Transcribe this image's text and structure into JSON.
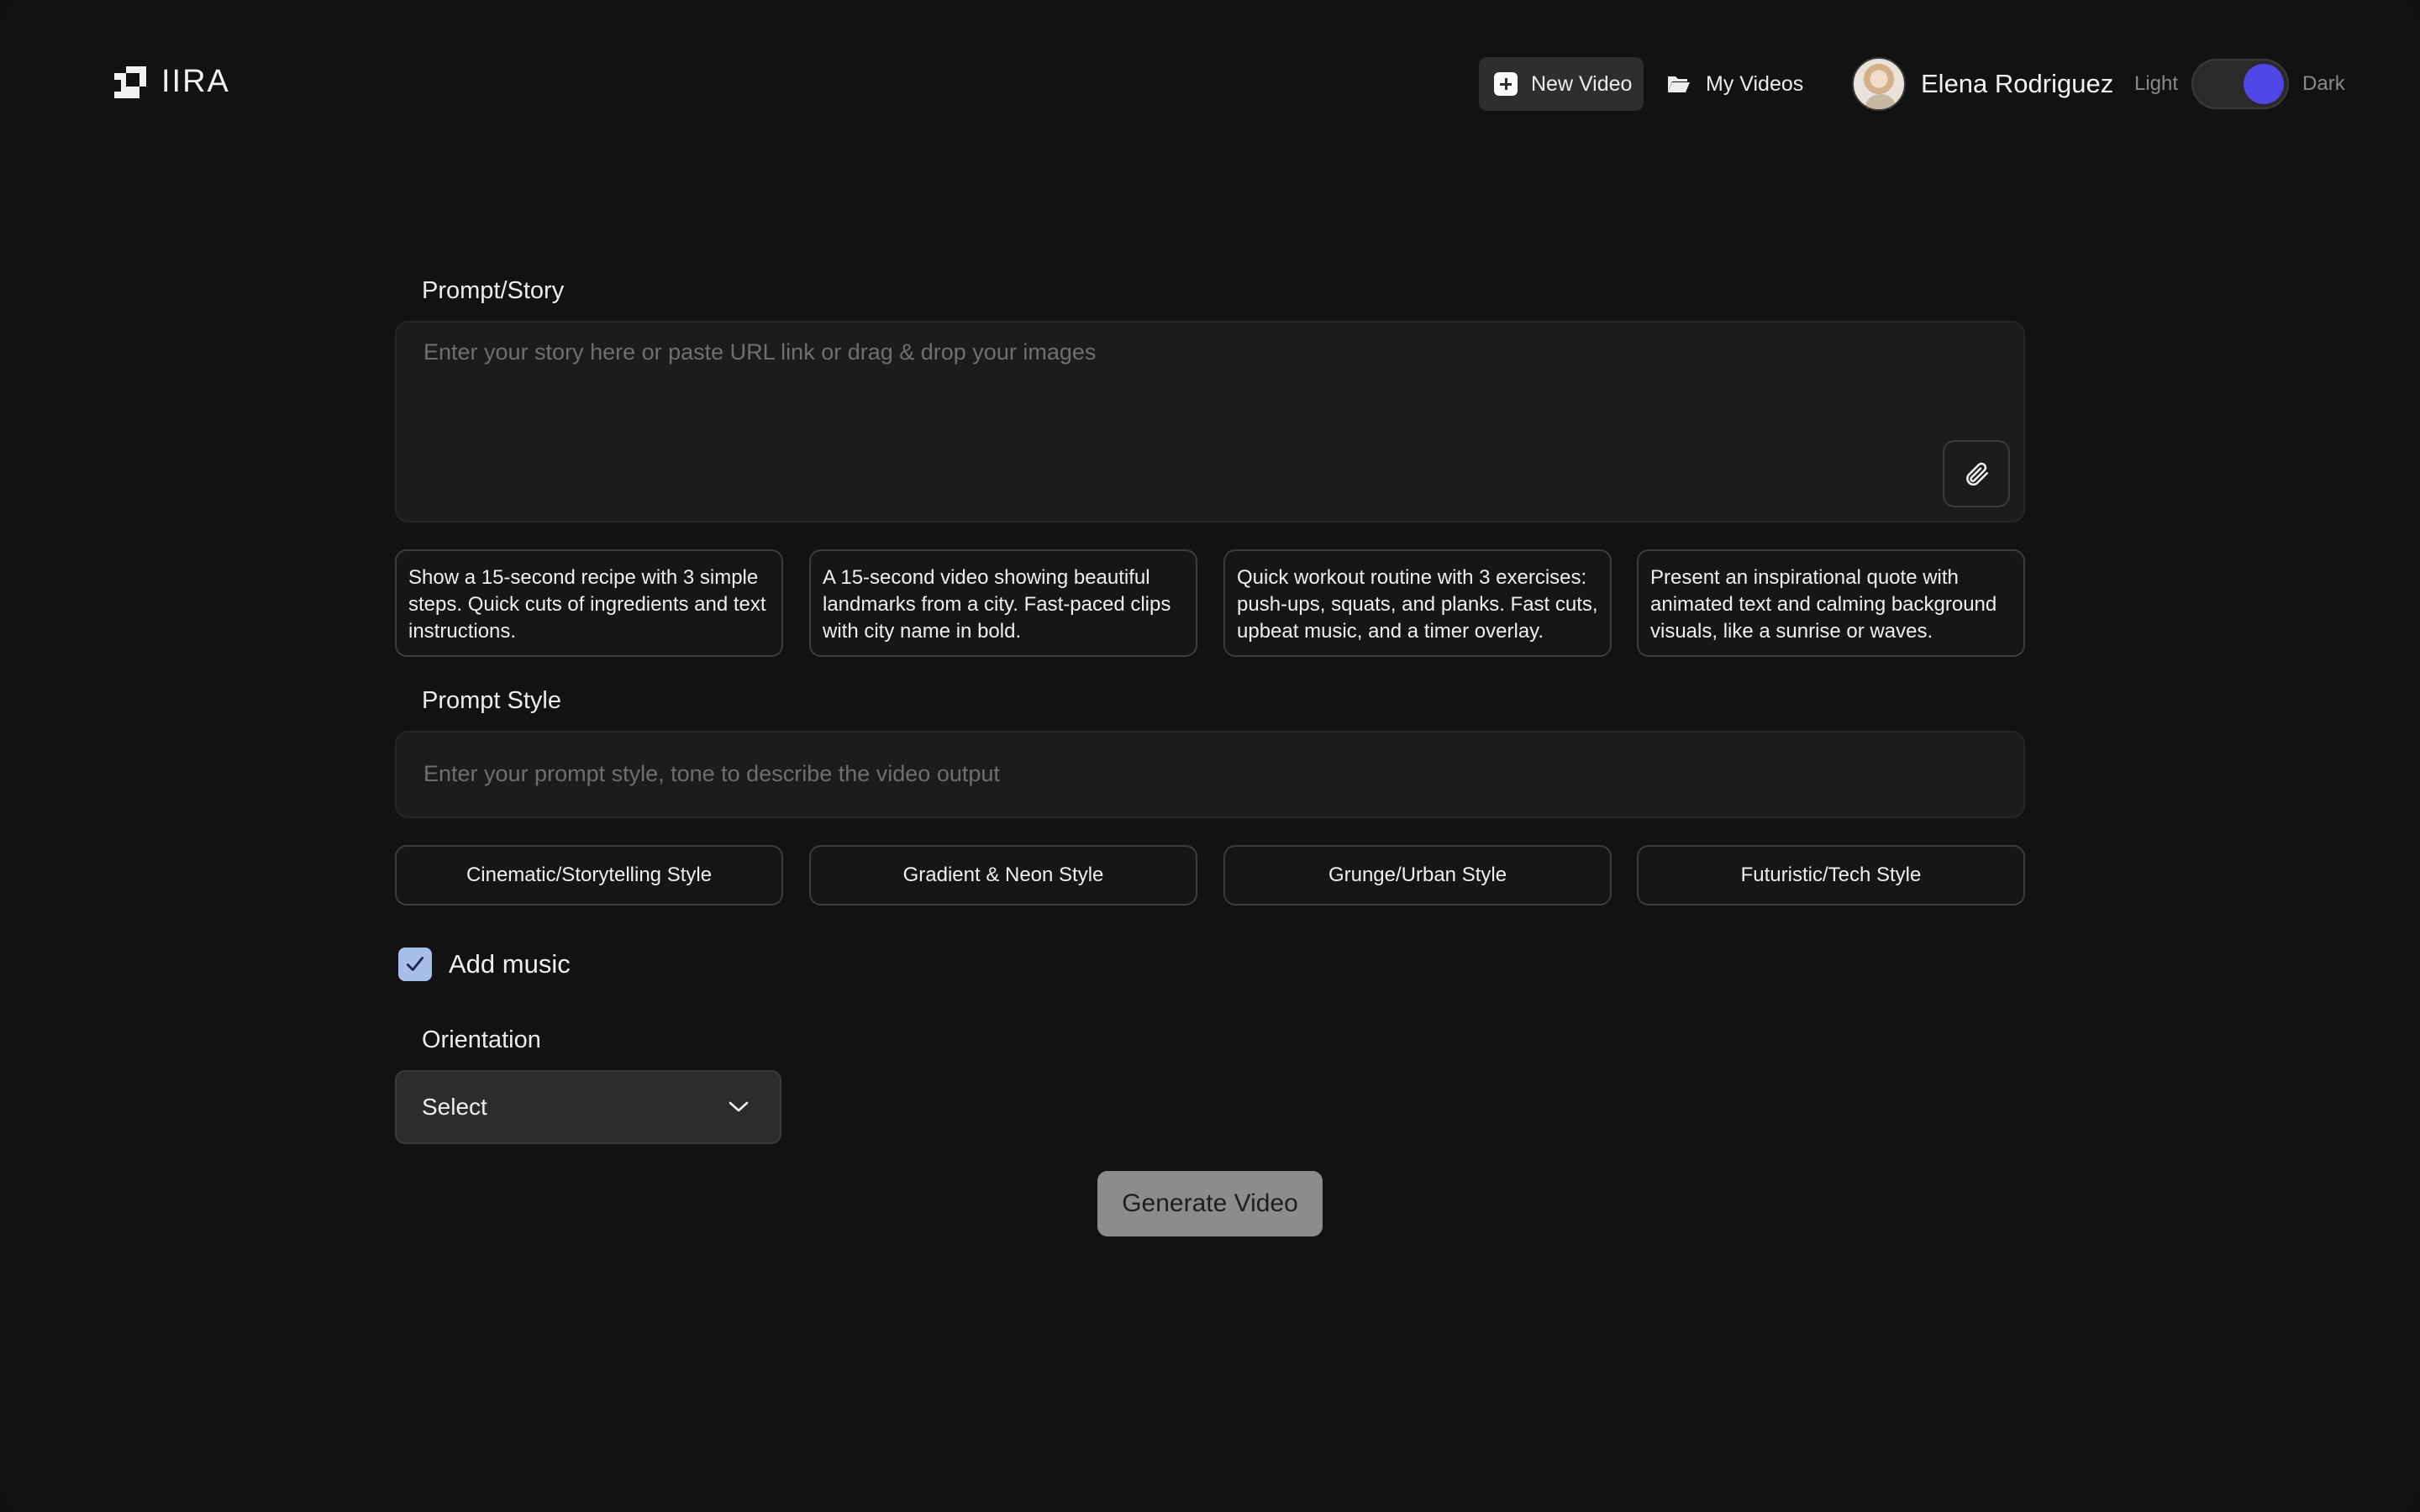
{
  "brand": {
    "name": "IIRA"
  },
  "nav": {
    "new_video": "New Video",
    "my_videos": "My Videos"
  },
  "user": {
    "name": "Elena Rodriguez"
  },
  "theme": {
    "light_label": "Light",
    "dark_label": "Dark",
    "mode": "dark",
    "accent": "#4f46e5"
  },
  "prompt": {
    "label": "Prompt/Story",
    "placeholder": "Enter your story here or paste URL link or drag & drop your images",
    "suggestions": [
      "Show a 15-second recipe with 3 simple steps. Quick cuts of ingredients and text instructions.",
      "A 15-second video showing beautiful landmarks from a city. Fast-paced clips with city name in bold.",
      "Quick workout routine with 3 exercises: push-ups, squats, and planks. Fast cuts, upbeat music, and a timer overlay.",
      "Present an inspirational quote with animated text and calming background visuals, like a sunrise or waves."
    ]
  },
  "prompt_style": {
    "label": "Prompt Style",
    "placeholder": "Enter your prompt style, tone to describe the video output",
    "options": [
      "Cinematic/Storytelling Style",
      "Gradient & Neon Style",
      "Grunge/Urban Style",
      "Futuristic/Tech Style"
    ]
  },
  "music": {
    "label": "Add music",
    "checked": true
  },
  "orientation": {
    "label": "Orientation",
    "value": "Select"
  },
  "generate": {
    "label": "Generate Video"
  }
}
